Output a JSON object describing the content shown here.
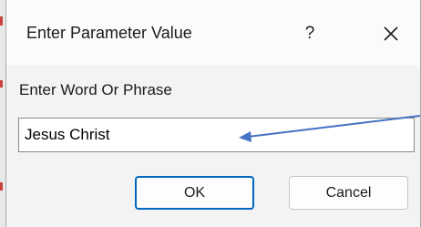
{
  "dialog": {
    "title": "Enter Parameter Value",
    "help_label": "?",
    "close_icon": "close-icon"
  },
  "prompt": {
    "label": "Enter Word Or Phrase",
    "value": "Jesus Christ"
  },
  "buttons": {
    "ok_label": "OK",
    "cancel_label": "Cancel"
  },
  "colors": {
    "accent": "#0067c0",
    "annotation_arrow": "#4472c4",
    "backdrop_mark": "#c8423e"
  }
}
